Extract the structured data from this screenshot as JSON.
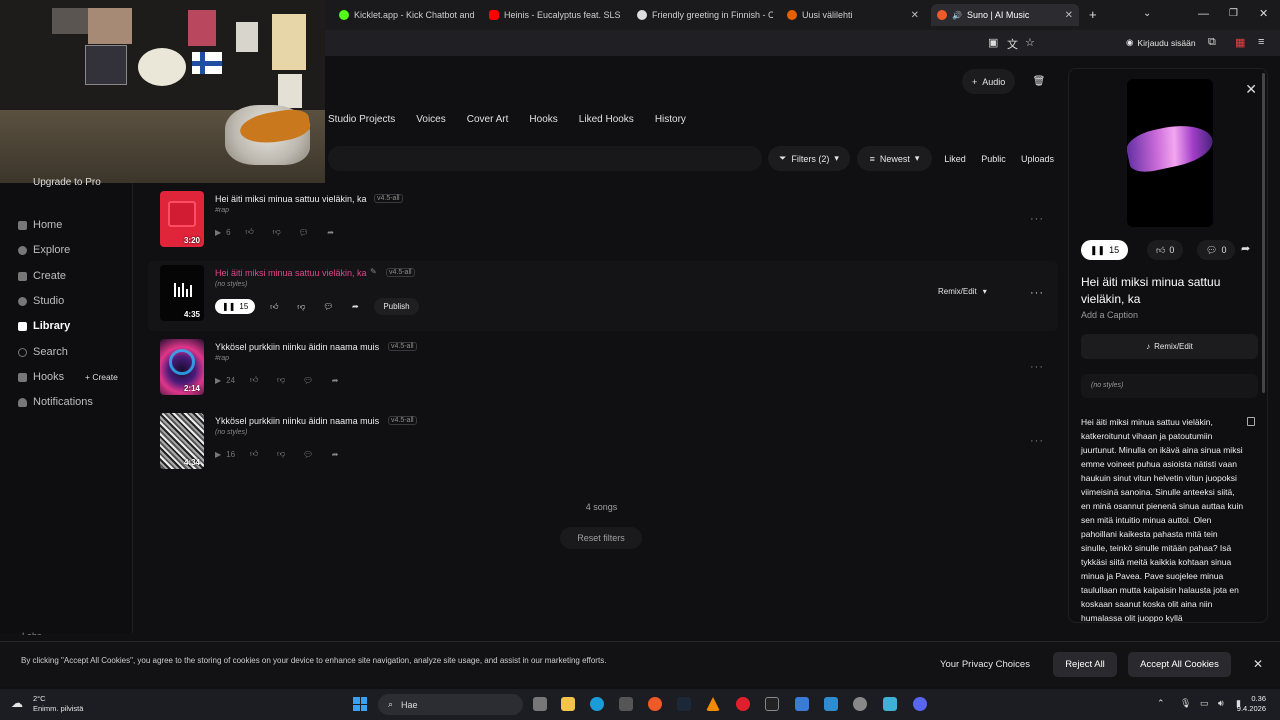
{
  "browser": {
    "tabs": [
      {
        "title": "Kicklet.app - Kick Chatbot and",
        "color": "#53fc18"
      },
      {
        "title": "Heinis - Eucalyptus feat. SLS - Yo",
        "color": "#ff0000"
      },
      {
        "title": "Friendly greeting in Finnish - Ch",
        "color": "#dddddd"
      },
      {
        "title": "Uusi välilehti",
        "color": "#e66000"
      },
      {
        "title": "Suno | AI Music",
        "color": "#f05a28"
      }
    ],
    "signin_label": "Kirjaudu sisään"
  },
  "sidebar": {
    "upgrade": "Upgrade to Pro",
    "items": [
      {
        "label": "Home"
      },
      {
        "label": "Explore"
      },
      {
        "label": "Create"
      },
      {
        "label": "Studio"
      },
      {
        "label": "Library"
      },
      {
        "label": "Search"
      },
      {
        "label": "Hooks"
      },
      {
        "label": "Notifications"
      }
    ],
    "hooks_create": "+ Create",
    "labs": "Labs"
  },
  "header": {
    "audio_label": "Audio"
  },
  "tabs": [
    "Studio Projects",
    "Voices",
    "Cover Art",
    "Hooks",
    "Liked Hooks",
    "History"
  ],
  "filters": {
    "filters_label": "Filters (2)",
    "sort_label": "Newest",
    "liked": "Liked",
    "public": "Public",
    "uploads": "Uploads"
  },
  "songs": [
    {
      "title": "Hei äiti miksi minua sattuu vieläkin, ka",
      "version": "v4.5-all",
      "style": "#rap",
      "duration": "3:20",
      "plays": "6"
    },
    {
      "title": "Hei äiti miksi minua sattuu vieläkin, ka",
      "version": "v4.5-all",
      "style": "(no styles)",
      "duration": "4:35",
      "plays": "15",
      "publish": "Publish",
      "remix": "Remix/Edit"
    },
    {
      "title": "Ykkösel purkkiin niinku äidin naama muis",
      "version": "v4.5-all",
      "style": "#rap",
      "duration": "2:14",
      "plays": "24"
    },
    {
      "title": "Ykkösel purkkiin niinku äidin naama muis",
      "version": "v4.5-all",
      "style": "(no styles)",
      "duration": "4:34",
      "plays": "16"
    }
  ],
  "list_footer": {
    "count": "4 songs",
    "reset": "Reset filters"
  },
  "detail": {
    "plays": "15",
    "likes": "0",
    "comments": "0",
    "title": "Hei äiti miksi minua sattuu vieläkin, ka",
    "caption": "Add a Caption",
    "remix": "Remix/Edit",
    "style": "(no styles)",
    "lyrics": "Hei äiti miksi minua sattuu vieläkin, katkeroitunut vihaan ja patoutumiin juurtunut. Minulla on ikävä aina sinua miksi emme voineet puhua asioista nätisti vaan haukuin sinut vitun helvetin vitun juopoksi viimeisinä sanoina. Sinulle anteeksi siitä, en minä osannut pienenä sinua auttaa kuin sen mitä intuitio minua auttoi. Olen pahoillani kaikesta pahasta mitä tein sinulle, teinkö sinulle mitään pahaa? Isä tykkäsi siitä meitä kaikkia kohtaan sinua minua ja Pavea. Pave suojelee minua taulullaan mutta kaipaisin halausta jota en koskaan saanut koska olit aina niin humalassa olit juoppo kyllä"
  },
  "cookie": {
    "text": "By clicking \"Accept All Cookies\", you agree to the storing of cookies on your device to enhance site navigation, analyze site usage, and assist in our marketing efforts.",
    "privacy": "Your Privacy Choices",
    "reject": "Reject All",
    "accept": "Accept All Cookies"
  },
  "taskbar": {
    "temp": "2°C",
    "weather": "Enimm. pilvistä",
    "search": "Hae",
    "time": "0.36",
    "date": "9.4.2026"
  },
  "colors": {
    "accent": "#e0458c",
    "cookie_button": "#2a2a2e"
  }
}
